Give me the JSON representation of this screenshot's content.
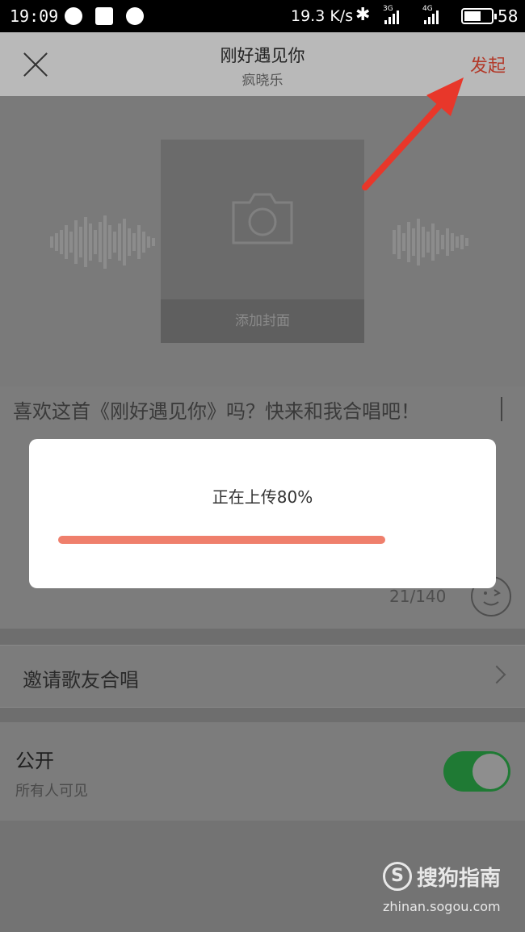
{
  "status_bar": {
    "time": "19:09",
    "net_speed": "19.3 K/s",
    "bluetooth_glyph": "✱",
    "network_1": "3G",
    "network_2": "4G",
    "battery_level": "58"
  },
  "header": {
    "title": "刚好遇见你",
    "subtitle": "疯晓乐",
    "launch_label": "发起"
  },
  "cover": {
    "add_cover_label": "添加封面"
  },
  "message": {
    "text": "喜欢这首《刚好遇见你》吗？快来和我合唱吧！",
    "counter": "21/140"
  },
  "dialog": {
    "status_text": "正在上传80%",
    "progress": 0.8
  },
  "invite": {
    "label": "邀请歌友合唱"
  },
  "visibility": {
    "label": "公开",
    "sublabel": "所有人可见",
    "enabled": true
  },
  "watermark": {
    "logo_letter": "S",
    "brand": "搜狗指南",
    "url": "zhinan.sogou.com"
  },
  "colors": {
    "launch": "#b23a2a",
    "progress_bar": "#ef7f6c",
    "toggle_on": "#1f7a34"
  },
  "icons": {
    "close": "close-icon",
    "camera": "camera-icon",
    "emoji": "emoji-icon",
    "chevron": "chevron-right-icon"
  }
}
